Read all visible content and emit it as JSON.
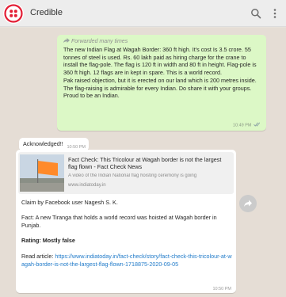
{
  "header": {
    "title": "Credible",
    "avatar_icon": "twilio-logo-icon",
    "brand_color": "#e31e35",
    "search_icon": "search-icon",
    "menu_icon": "more-vertical-icon"
  },
  "messages": {
    "outgoing": {
      "forwarded_label": "Forwarded many times",
      "paragraphs": [
        "The new Indian Flag at Wagah Border:  360 ft high. It's cost Is  3.5 crore. 55 tonnes of steel is used. Rs. 60 lakh paid as hiring charge for the crane to install the flag-pole. The flag is 120 ft in width and 80 ft in height.  Flag-pole is 360 ft high. 12 flags are in kept in spare. This is a world record.",
        "Pak raised objection, but it is erected on our land which is 200 metres inside. The flag-raising is admirable for every Indian. Do share it with your groups.",
        " Proud to be an Indian."
      ],
      "time": "10:49 PM",
      "status_icon": "double-check-icon",
      "bubble_color": "#dcf8c6"
    },
    "ack": {
      "text": "Acknowledged!!",
      "time": "10:50 PM"
    },
    "incoming": {
      "preview": {
        "title": "Fact Check: This Tricolour at Wagah border is not the largest flag flown - Fact Check News",
        "description": "A video of the Indian National flag hoisting ceremony is going",
        "domain": "www.indiatoday.in"
      },
      "claim": "Claim by Facebook user Nagesh S. K.",
      "fact": "Fact: A new Tiranga that holds a world record was hoisted at Wagah border in Punjab.",
      "rating": "Rating: Mostly false",
      "read_label": "Read article: ",
      "link": "https://www.indiatoday.in/fact-check/story/fact-check-this-tricolour-at-wagah-border-is-not-the-largest-flag-flown-1718875-2020-09-05",
      "time": "10:50 PM",
      "link_color": "#1f7ac9"
    }
  },
  "share_icon": "forward-share-icon"
}
